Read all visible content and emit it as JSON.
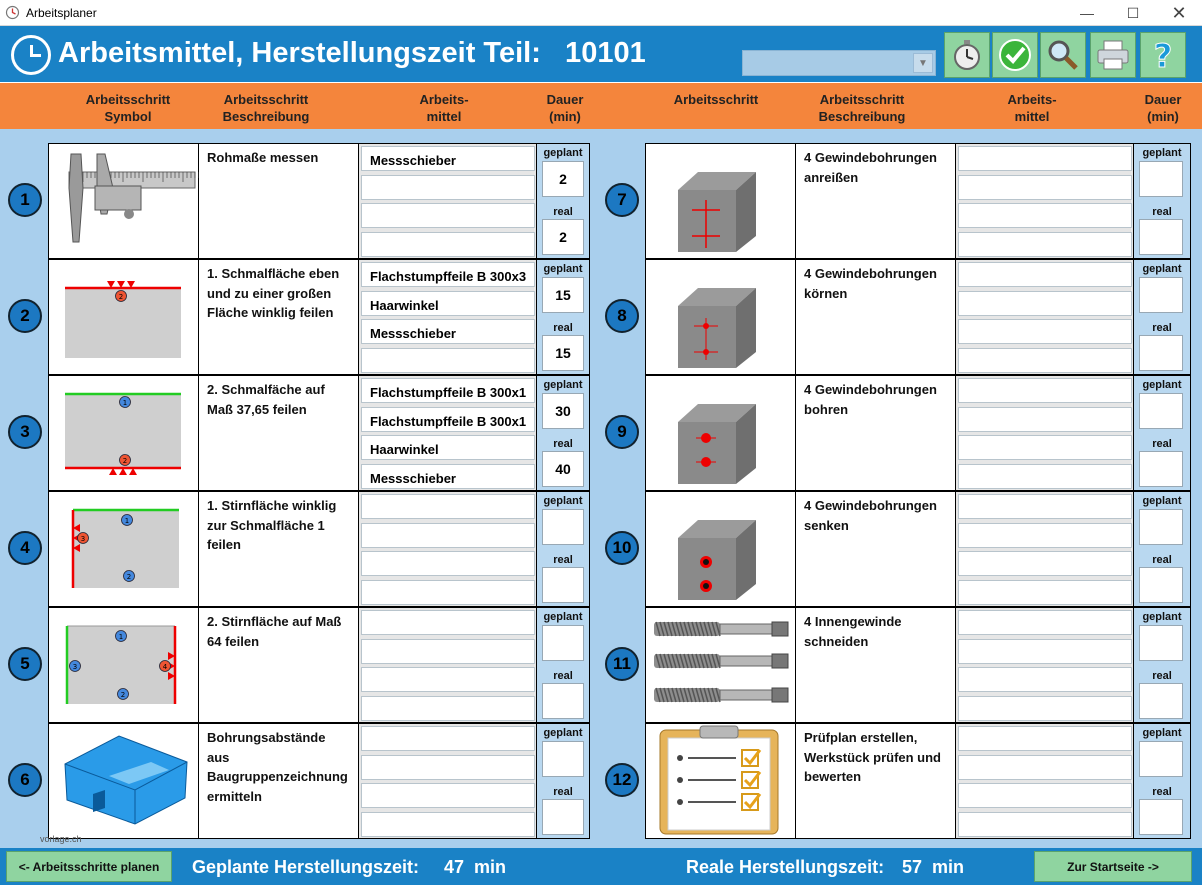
{
  "window": {
    "title": "Arbeitsplaner"
  },
  "header": {
    "title": "Arbeitsmittel, Herstellungszeit Teil:   10101",
    "combo_value": ""
  },
  "toolbar": [
    "stopwatch-icon",
    "checkmark-icon",
    "magnifier-icon",
    "printer-icon",
    "help-icon"
  ],
  "columns": {
    "symbol": "Arbeitsschritt\nSymbol",
    "beschreibung": "Arbeitsschritt\nBeschreibung",
    "mittel": "Arbeits-\nmittel",
    "dauer": "Dauer\n(min)",
    "symbol_r": "Arbeitsschritt",
    "beschreibung_r": "Arbeitsschritt\nBeschreibung",
    "mittel_r": "Arbeits-\nmittel",
    "dauer_r": "Dauer\n(min)"
  },
  "labels": {
    "geplant": "geplant",
    "real": "real"
  },
  "steps": [
    {
      "num": "1",
      "desc": "Rohmaße messen",
      "tools": [
        "Messschieber",
        "",
        "",
        ""
      ],
      "geplant": "2",
      "real": "2",
      "icon": "caliper-icon"
    },
    {
      "num": "2",
      "desc": "1. Schmalfläche eben und zu einer großen Fläche winklig feilen",
      "tools": [
        "Flachstumpffeile B 300x3",
        "Haarwinkel",
        "Messschieber",
        ""
      ],
      "geplant": "15",
      "real": "15",
      "icon": "filing-top-icon"
    },
    {
      "num": "3",
      "desc": "2. Schmalfäche auf Maß 37,65 feilen",
      "tools": [
        "Flachstumpffeile B 300x1",
        "Flachstumpffeile B 300x1",
        "Haarwinkel",
        "Messschieber"
      ],
      "geplant": "30",
      "real": "40",
      "icon": "filing-bottom-icon"
    },
    {
      "num": "4",
      "desc": "1. Stirnfläche winklig zur Schmalfläche 1 feilen",
      "tools": [
        "",
        "",
        "",
        ""
      ],
      "geplant": "",
      "real": "",
      "icon": "filing-left-icon"
    },
    {
      "num": "5",
      "desc": "2. Stirnfläche  auf Maß 64 feilen",
      "tools": [
        "",
        "",
        "",
        ""
      ],
      "geplant": "",
      "real": "",
      "icon": "filing-right-icon"
    },
    {
      "num": "6",
      "desc": "Bohrungsabstände aus Baugruppenzeichnung ermitteln",
      "tools": [
        "",
        "",
        "",
        ""
      ],
      "geplant": "",
      "real": "",
      "icon": "assembly-drawing-icon"
    },
    {
      "num": "7",
      "desc": "4 Gewindebohrungen anreißen",
      "tools": [
        "",
        "",
        "",
        ""
      ],
      "geplant": "",
      "real": "",
      "icon": "block-marking-icon"
    },
    {
      "num": "8",
      "desc": "4 Gewindebohrungen körnen",
      "tools": [
        "",
        "",
        "",
        ""
      ],
      "geplant": "",
      "real": "",
      "icon": "block-punching-icon"
    },
    {
      "num": "9",
      "desc": "4 Gewindebohrungen bohren",
      "tools": [
        "",
        "",
        "",
        ""
      ],
      "geplant": "",
      "real": "",
      "icon": "block-drilling-icon"
    },
    {
      "num": "10",
      "desc": "4 Gewindebohrungen senken",
      "tools": [
        "",
        "",
        "",
        ""
      ],
      "geplant": "",
      "real": "",
      "icon": "block-countersink-icon"
    },
    {
      "num": "11",
      "desc": "4 Innengewinde schneiden",
      "tools": [
        "",
        "",
        "",
        ""
      ],
      "geplant": "",
      "real": "",
      "icon": "taps-icon"
    },
    {
      "num": "12",
      "desc": "Prüfplan erstellen, Werkstück prüfen und bewerten",
      "tools": [
        "",
        "",
        "",
        ""
      ],
      "geplant": "",
      "real": "",
      "icon": "clipboard-checklist-icon"
    }
  ],
  "watermark": "vorlage.ch",
  "footer": {
    "back_label": "<- Arbeitsschritte planen",
    "planned_label": "Geplante Herstellungszeit:",
    "planned_value": "47  min",
    "real_label": "Reale Herstellungszeit:",
    "real_value": "57  min",
    "home_label": "Zur Startseite ->"
  },
  "colors": {
    "header": "#1a82c6",
    "column_header": "#f4853c",
    "background": "#a9cfed",
    "button": "#8fd4a0"
  }
}
